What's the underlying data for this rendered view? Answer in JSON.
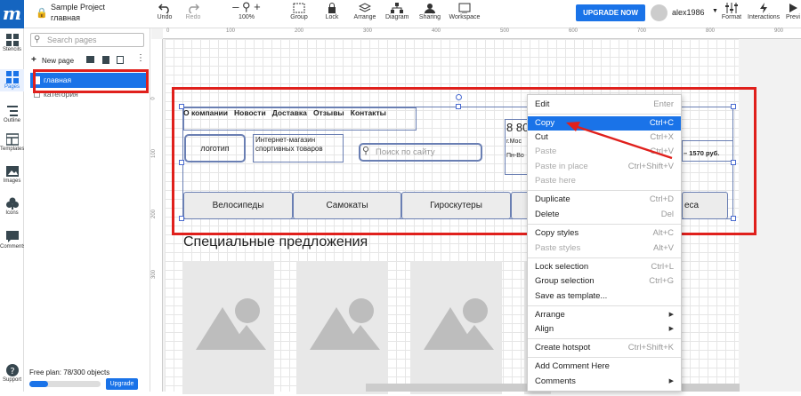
{
  "app": {
    "logo_letter": "m",
    "project_name": "Sample Project",
    "page_name": "главная"
  },
  "toolbar": {
    "undo": "Undo",
    "redo": "Redo",
    "zoom": "100%",
    "group": "Group",
    "lock": "Lock",
    "arrange": "Arrange",
    "diagram": "Diagram",
    "sharing": "Sharing",
    "workspace": "Workspace",
    "upgrade_now": "UPGRADE NOW",
    "username": "alex1986",
    "format": "Format",
    "interactions": "Interactions",
    "preview": "Previ"
  },
  "left_sidebar": {
    "items": [
      {
        "label": "Stencils",
        "icon": "stencils-icon"
      },
      {
        "label": "Pages",
        "icon": "pages-icon"
      },
      {
        "label": "Outline",
        "icon": "outline-icon"
      },
      {
        "label": "Templates",
        "icon": "templates-icon"
      },
      {
        "label": "Images",
        "icon": "images-icon"
      },
      {
        "label": "Icons",
        "icon": "icons-icon"
      },
      {
        "label": "Comments",
        "icon": "comments-icon"
      },
      {
        "label": "Support",
        "icon": "support-icon"
      }
    ]
  },
  "pages_panel": {
    "search_placeholder": "Search pages",
    "new_page": "New page",
    "pages": [
      "главная",
      "категория"
    ],
    "plan_text": "Free plan: 78/300 objects",
    "plan_progress": 0.26,
    "upgrade": "Upgrade"
  },
  "rulers": {
    "top": [
      "0",
      "100",
      "200",
      "300",
      "400",
      "500",
      "600",
      "700",
      "800",
      "900"
    ],
    "left": [
      "0",
      "100",
      "200",
      "300"
    ]
  },
  "mockup": {
    "nav": [
      "О компании",
      "Новости",
      "Доставка",
      "Отзывы",
      "Контакты"
    ],
    "logo": "логотип",
    "tagline": "Интернет-магазин спортивных товаров",
    "search": "Поиск по сайту",
    "phone": "8 80",
    "city": "г.Мос",
    "hours": "Пн-Во",
    "cart": "– 1570 руб.",
    "categories": [
      "Велосипеды",
      "Самокаты",
      "Гироскутеры",
      "",
      "еса"
    ],
    "special_title": "Специальные предложения"
  },
  "context_menu": {
    "items": [
      {
        "label": "Edit",
        "shortcut": "Enter",
        "disabled": false
      },
      {
        "label": "Copy",
        "shortcut": "Ctrl+C",
        "disabled": false,
        "highlighted": true
      },
      {
        "label": "Cut",
        "shortcut": "Ctrl+X",
        "disabled": false
      },
      {
        "label": "Paste",
        "shortcut": "Ctrl+V",
        "disabled": true
      },
      {
        "label": "Paste in place",
        "shortcut": "Ctrl+Shift+V",
        "disabled": true
      },
      {
        "label": "Paste here",
        "shortcut": "",
        "disabled": true
      },
      {
        "label": "Duplicate",
        "shortcut": "Ctrl+D",
        "disabled": false
      },
      {
        "label": "Delete",
        "shortcut": "Del",
        "disabled": false
      },
      {
        "label": "Copy styles",
        "shortcut": "Alt+C",
        "disabled": false
      },
      {
        "label": "Paste styles",
        "shortcut": "Alt+V",
        "disabled": true
      },
      {
        "label": "Lock selection",
        "shortcut": "Ctrl+L",
        "disabled": false
      },
      {
        "label": "Group selection",
        "shortcut": "Ctrl+G",
        "disabled": false
      },
      {
        "label": "Save as template...",
        "shortcut": "",
        "disabled": false
      },
      {
        "label": "Arrange",
        "shortcut": "▶",
        "disabled": false
      },
      {
        "label": "Align",
        "shortcut": "▶",
        "disabled": false
      },
      {
        "label": "Create hotspot",
        "shortcut": "Ctrl+Shift+K",
        "disabled": false
      },
      {
        "label": "Add Comment Here",
        "shortcut": "",
        "disabled": false
      },
      {
        "label": "Comments",
        "shortcut": "▶",
        "disabled": false
      }
    ]
  },
  "colors": {
    "accent": "#1a73e8",
    "annotation_red": "#e0201c",
    "wire": "#6a7fb3"
  }
}
